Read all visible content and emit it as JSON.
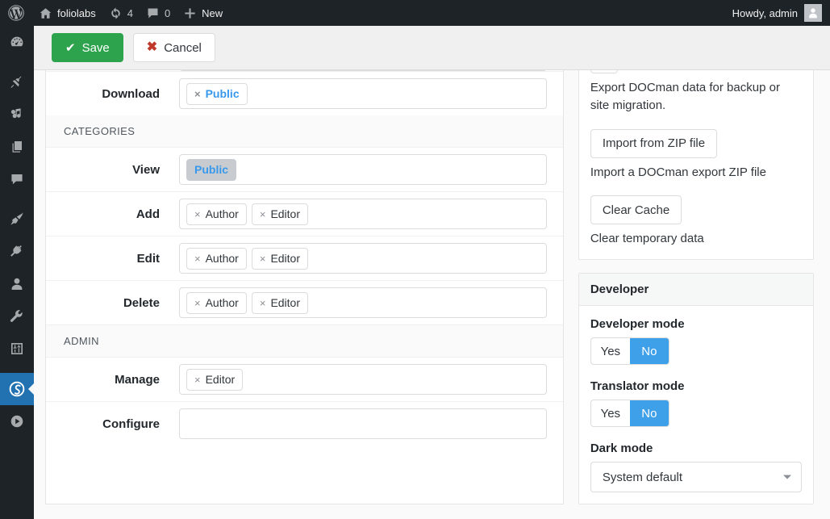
{
  "adminbar": {
    "logo_icon": "wordpress-logo-icon",
    "site_name": "foliolabs",
    "site_icon": "home-icon",
    "updates_icon": "updates-icon",
    "updates_count": "4",
    "comments_icon": "comments-icon",
    "comments_count": "0",
    "new_icon": "plus-icon",
    "new_label": "New",
    "howdy": "Howdy, admin",
    "avatar_icon": "user-avatar-icon"
  },
  "sidebar": {
    "items": [
      {
        "name": "dashboard",
        "icon": "dashboard-icon",
        "active": false
      },
      {
        "name": "posts",
        "icon": "pin-icon",
        "active": false
      },
      {
        "name": "media",
        "icon": "media-icon",
        "active": false
      },
      {
        "name": "pages",
        "icon": "pages-icon",
        "active": false
      },
      {
        "name": "comments",
        "icon": "comment-bubble-icon",
        "active": false
      },
      {
        "name": "appearance",
        "icon": "paintbrush-icon",
        "active": false
      },
      {
        "name": "plugins",
        "icon": "plug-icon",
        "active": false
      },
      {
        "name": "users",
        "icon": "user-icon",
        "active": false
      },
      {
        "name": "tools",
        "icon": "wrench-icon",
        "active": false
      },
      {
        "name": "settings",
        "icon": "sliders-icon",
        "active": false
      },
      {
        "name": "docman",
        "icon": "docman-spiral-icon",
        "active": true
      },
      {
        "name": "media-player",
        "icon": "play-circle-icon",
        "active": false
      }
    ]
  },
  "toolbar": {
    "save_label": "Save",
    "save_icon": "checkmark-icon",
    "cancel_label": "Cancel",
    "cancel_icon": "x-mark-icon"
  },
  "form": {
    "rows_top": [
      {
        "label": "Download",
        "tags": [
          {
            "text": "Public",
            "style": "blue",
            "removable": true
          }
        ]
      }
    ],
    "sections": [
      {
        "title": "CATEGORIES",
        "rows": [
          {
            "label": "View",
            "tags": [
              {
                "text": "Public",
                "style": "locked",
                "removable": false
              }
            ]
          },
          {
            "label": "Add",
            "tags": [
              {
                "text": "Author",
                "style": "plain",
                "removable": true
              },
              {
                "text": "Editor",
                "style": "plain",
                "removable": true
              }
            ]
          },
          {
            "label": "Edit",
            "tags": [
              {
                "text": "Author",
                "style": "plain",
                "removable": true
              },
              {
                "text": "Editor",
                "style": "plain",
                "removable": true
              }
            ]
          },
          {
            "label": "Delete",
            "tags": [
              {
                "text": "Author",
                "style": "plain",
                "removable": true
              },
              {
                "text": "Editor",
                "style": "plain",
                "removable": true
              }
            ]
          }
        ]
      },
      {
        "title": "ADMIN",
        "rows": [
          {
            "label": "Manage",
            "tags": [
              {
                "text": "Editor",
                "style": "plain",
                "removable": true
              }
            ]
          },
          {
            "label": "Configure",
            "tags": []
          }
        ]
      }
    ],
    "remove_icon": "remove-tag-icon",
    "remove_glyph": "×"
  },
  "tools_panel": {
    "export_desc": "Export DOCman data for backup or site migration.",
    "import_label": "Import from ZIP file",
    "import_desc": "Import a DOCman export ZIP file",
    "clear_label": "Clear Cache",
    "clear_desc": "Clear temporary data"
  },
  "developer_panel": {
    "title": "Developer",
    "developer_mode": {
      "label": "Developer mode",
      "options": [
        "Yes",
        "No"
      ],
      "selected": "No"
    },
    "translator_mode": {
      "label": "Translator mode",
      "options": [
        "Yes",
        "No"
      ],
      "selected": "No"
    },
    "dark_mode": {
      "label": "Dark mode",
      "value": "System default",
      "arrow_icon": "chevron-down-icon"
    }
  },
  "colors": {
    "admin_dark": "#1d2327",
    "accent_blue": "#2271b1",
    "toggle_blue": "#3da0e8",
    "tag_blue": "#3899ec",
    "save_green": "#2ea34d",
    "cancel_red": "#c0392b",
    "locked_grey": "#c8ccd0"
  }
}
